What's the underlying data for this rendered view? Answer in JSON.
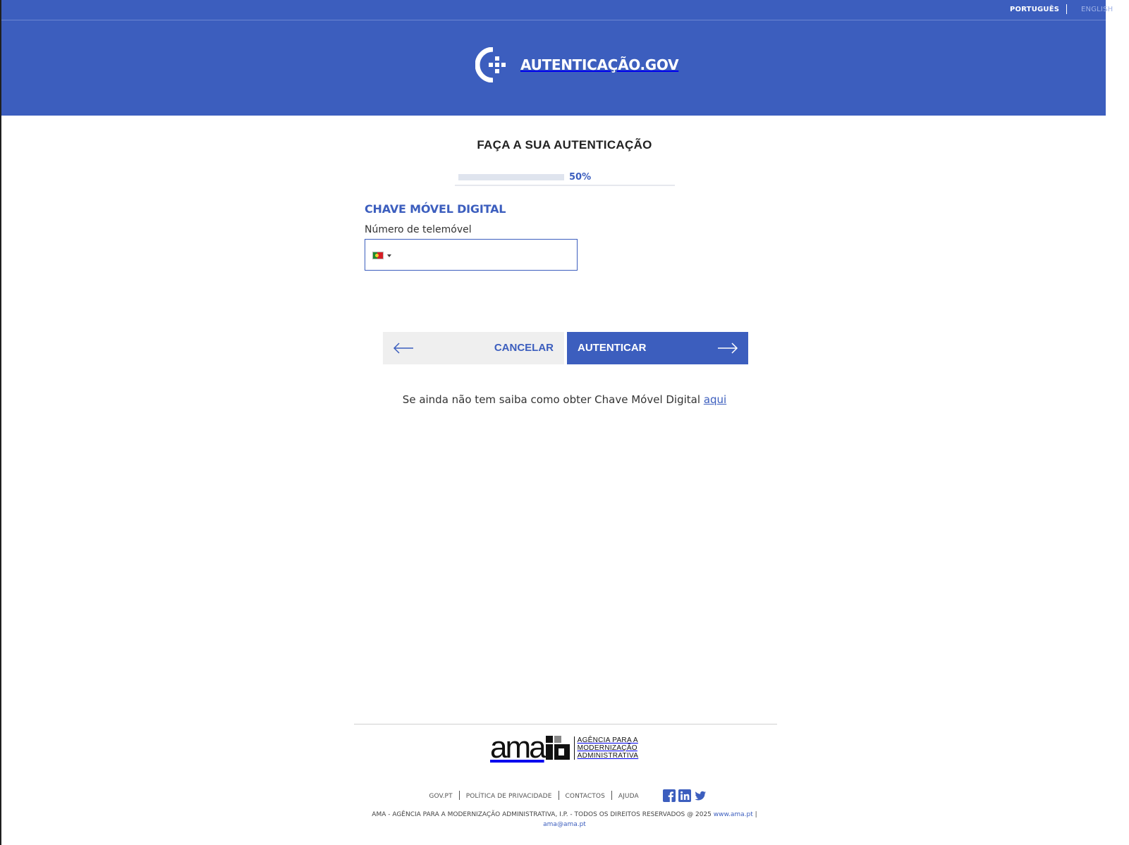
{
  "languages": {
    "portuguese": "PORTUGUÊS",
    "english": "ENGLISH",
    "active": "PORTUGUÊS"
  },
  "brand": {
    "name": "AUTENTICAÇÃO.GOV",
    "logo_icon": "autenticacao-gov-logo-icon"
  },
  "page": {
    "title": "FAÇA A SUA AUTENTICAÇÃO",
    "progress_label": "50%",
    "progress_value": 0.5
  },
  "form": {
    "section_title": "CHAVE MÓVEL DIGITAL",
    "phone_label": "Número de telemóvel",
    "phone_value": "",
    "country_flag_icon": "portugal-flag-icon"
  },
  "buttons": {
    "cancel": "CANCELAR",
    "authenticate": "AUTENTICAR"
  },
  "help": {
    "text": "Se ainda não tem saiba como obter Chave Móvel Digital ",
    "link": "aqui"
  },
  "footer": {
    "ama_word": "ama",
    "ama_tagline_1": "AGÊNCIA PARA A",
    "ama_tagline_2": "MODERNIZAÇÃO",
    "ama_tagline_3": "ADMINISTRATIVA",
    "links": [
      "GOV.PT",
      "POLÍTICA DE PRIVACIDADE",
      "CONTACTOS",
      "AJUDA"
    ],
    "social_icons": [
      "facebook-icon",
      "linkedin-icon",
      "twitter-icon"
    ],
    "copyright": "AMA - AGÊNCIA PARA A MODERNIZAÇÃO ADMINISTRATIVA, I.P. - TODOS OS DIREITOS RESERVADOS @ 2025 ",
    "website": "www.ama.pt",
    "pipe": " |",
    "email": "ama@ama.pt"
  },
  "colors": {
    "primary": "#3c5ebe",
    "header_background": "#3c5ebe",
    "cancel_background": "#efefef"
  }
}
